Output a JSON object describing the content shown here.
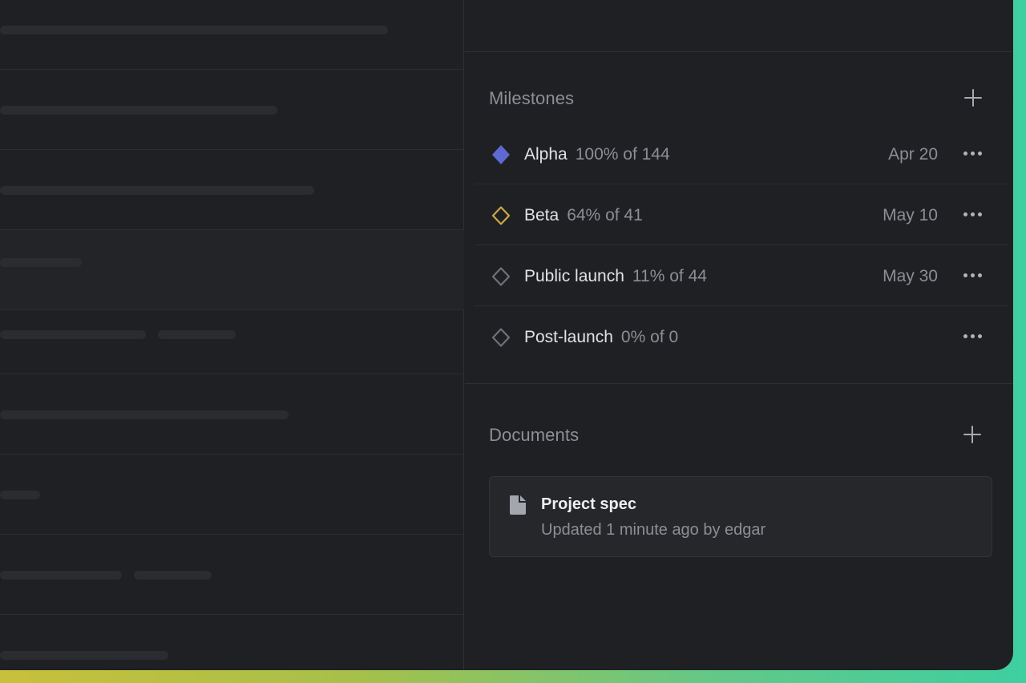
{
  "milestones": {
    "title": "Milestones",
    "items": [
      {
        "name": "Alpha",
        "progress": "100% of 144",
        "date": "Apr 20",
        "icon": "diamond-filled-icon",
        "color": "#5e6ad2"
      },
      {
        "name": "Beta",
        "progress": "64% of 41",
        "date": "May 10",
        "icon": "diamond-outline-icon",
        "color": "#c9a849"
      },
      {
        "name": "Public launch",
        "progress": "11% of 44",
        "date": "May 30",
        "icon": "diamond-outline-icon",
        "color": "#6e7179"
      },
      {
        "name": "Post-launch",
        "progress": "0% of 0",
        "date": "",
        "icon": "diamond-outline-icon",
        "color": "#6e7179"
      }
    ]
  },
  "documents": {
    "title": "Documents",
    "items": [
      {
        "title": "Project spec",
        "subtitle": "Updated 1 minute ago by edgar",
        "icon": "document-icon"
      }
    ]
  },
  "colors": {
    "background": "#1f2023",
    "accent": "#5e6ad2"
  }
}
